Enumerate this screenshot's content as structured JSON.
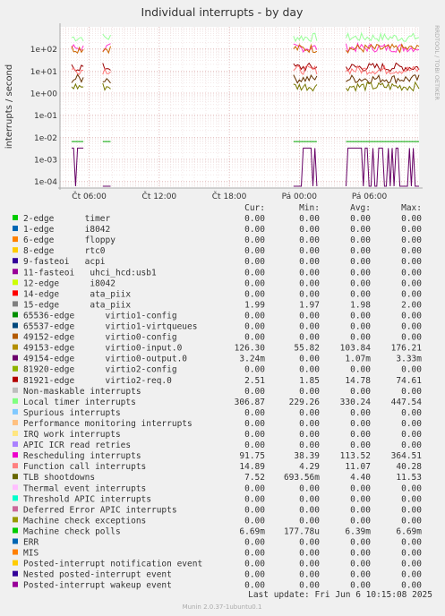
{
  "chart_data": {
    "type": "line",
    "title": "Individual interrupts - by day",
    "ylabel": "interrupts / second",
    "side_label": "RRDTOOL / TOBI OETIKER",
    "y_scale": "log",
    "ylim": [
      5e-05,
      1000
    ],
    "y_ticks": [
      "1e+02",
      "1e+01",
      "1e+00",
      "1e-01",
      "1e-02",
      "1e-03",
      "1e-04"
    ],
    "y_tick_values": [
      100,
      10,
      1,
      0.1,
      0.01,
      0.001,
      0.0001
    ],
    "x_ticks": [
      "Čt 06:00",
      "Čt 12:00",
      "Čt 18:00",
      "Pá 00:00",
      "Pá 06:00"
    ],
    "grid": true,
    "series_active_periods": [
      [
        "Čt 04:30",
        "Čt 05:30"
      ],
      [
        "Čt 07:10",
        "Čt 07:50"
      ],
      [
        "Čt 23:30",
        "Pá 01:30"
      ],
      [
        "Pá 04:00",
        "Pá 10:15"
      ]
    ],
    "series": [
      {
        "name": "Local timer interrupts",
        "color": "#99ff99",
        "level": 330
      },
      {
        "name": "Rescheduling interrupts",
        "color": "#ff33cc",
        "level": 113
      },
      {
        "name": "49153-edge virtio0-input.0",
        "color": "#cc6600",
        "level": 104
      },
      {
        "name": "TLB shootdowns",
        "color": "#663300",
        "level": 4.4
      },
      {
        "name": "81921-edge virtio2-req.0",
        "color": "#990000",
        "level": 14.78
      },
      {
        "name": "Function call interrupts",
        "color": "#ff7777",
        "level": 11.07
      },
      {
        "name": "15-edge ata_piix",
        "color": "#777700",
        "level": 1.98
      },
      {
        "name": "Machine check polls",
        "color": "#00aa00",
        "level": 0.00639
      },
      {
        "name": "49154-edge virtio0-output.0",
        "color": "#660066",
        "level": 0.00107
      }
    ]
  },
  "legend": {
    "headers": {
      "cur": "Cur:",
      "min": "Min:",
      "avg": "Avg:",
      "max": "Max:"
    },
    "rows": [
      {
        "label": "2-edge      timer",
        "color": "#00cc00",
        "cur": "0.00",
        "min": "0.00",
        "avg": "0.00",
        "max": "0.00"
      },
      {
        "label": "1-edge      i8042",
        "color": "#0066b3",
        "cur": "0.00",
        "min": "0.00",
        "avg": "0.00",
        "max": "0.00"
      },
      {
        "label": "6-edge      floppy",
        "color": "#ff8000",
        "cur": "0.00",
        "min": "0.00",
        "avg": "0.00",
        "max": "0.00"
      },
      {
        "label": "8-edge      rtc0",
        "color": "#ffcc00",
        "cur": "0.00",
        "min": "0.00",
        "avg": "0.00",
        "max": "0.00"
      },
      {
        "label": "9-fasteoi   acpi",
        "color": "#330099",
        "cur": "0.00",
        "min": "0.00",
        "avg": "0.00",
        "max": "0.00"
      },
      {
        "label": "11-fasteoi   uhci_hcd:usb1",
        "color": "#990099",
        "cur": "0.00",
        "min": "0.00",
        "avg": "0.00",
        "max": "0.00"
      },
      {
        "label": "12-edge      i8042",
        "color": "#ccff00",
        "cur": "0.00",
        "min": "0.00",
        "avg": "0.00",
        "max": "0.00"
      },
      {
        "label": "14-edge      ata_piix",
        "color": "#ff0000",
        "cur": "0.00",
        "min": "0.00",
        "avg": "0.00",
        "max": "0.00"
      },
      {
        "label": "15-edge      ata_piix",
        "color": "#808080",
        "cur": "1.99",
        "min": "1.97",
        "avg": "1.98",
        "max": "2.00"
      },
      {
        "label": "65536-edge      virtio1-config",
        "color": "#008f00",
        "cur": "0.00",
        "min": "0.00",
        "avg": "0.00",
        "max": "0.00"
      },
      {
        "label": "65537-edge      virtio1-virtqueues",
        "color": "#00487d",
        "cur": "0.00",
        "min": "0.00",
        "avg": "0.00",
        "max": "0.00"
      },
      {
        "label": "49152-edge      virtio0-config",
        "color": "#b35a00",
        "cur": "0.00",
        "min": "0.00",
        "avg": "0.00",
        "max": "0.00"
      },
      {
        "label": "49153-edge      virtio0-input.0",
        "color": "#b38f00",
        "cur": "126.30",
        "min": "55.82",
        "avg": "103.84",
        "max": "176.21"
      },
      {
        "label": "49154-edge      virtio0-output.0",
        "color": "#6b006b",
        "cur": "3.24m",
        "min": "0.00",
        "avg": "1.07m",
        "max": "3.33m"
      },
      {
        "label": "81920-edge      virtio2-config",
        "color": "#8fb300",
        "cur": "0.00",
        "min": "0.00",
        "avg": "0.00",
        "max": "0.00"
      },
      {
        "label": "81921-edge      virtio2-req.0",
        "color": "#b30000",
        "cur": "2.51",
        "min": "1.85",
        "avg": "14.78",
        "max": "74.61"
      },
      {
        "label": "Non-maskable interrupts",
        "color": "#bebebe",
        "cur": "0.00",
        "min": "0.00",
        "avg": "0.00",
        "max": "0.00"
      },
      {
        "label": "Local timer interrupts",
        "color": "#80ff80",
        "cur": "306.87",
        "min": "229.26",
        "avg": "330.24",
        "max": "447.54"
      },
      {
        "label": "Spurious interrupts",
        "color": "#80c9ff",
        "cur": "0.00",
        "min": "0.00",
        "avg": "0.00",
        "max": "0.00"
      },
      {
        "label": "Performance monitoring interrupts",
        "color": "#ffc080",
        "cur": "0.00",
        "min": "0.00",
        "avg": "0.00",
        "max": "0.00"
      },
      {
        "label": "IRQ work interrupts",
        "color": "#ffe680",
        "cur": "0.00",
        "min": "0.00",
        "avg": "0.00",
        "max": "0.00"
      },
      {
        "label": "APIC ICR read retries",
        "color": "#aa80ff",
        "cur": "0.00",
        "min": "0.00",
        "avg": "0.00",
        "max": "0.00"
      },
      {
        "label": "Rescheduling interrupts",
        "color": "#ee00cc",
        "cur": "91.75",
        "min": "38.39",
        "avg": "113.52",
        "max": "364.51"
      },
      {
        "label": "Function call interrupts",
        "color": "#ff8080",
        "cur": "14.89",
        "min": "4.29",
        "avg": "11.07",
        "max": "40.28"
      },
      {
        "label": "TLB shootdowns",
        "color": "#666600",
        "cur": "7.52",
        "min": "693.56m",
        "avg": "4.40",
        "max": "11.53"
      },
      {
        "label": "Thermal event interrupts",
        "color": "#ffbfff",
        "cur": "0.00",
        "min": "0.00",
        "avg": "0.00",
        "max": "0.00"
      },
      {
        "label": "Threshold APIC interrupts",
        "color": "#00ffcc",
        "cur": "0.00",
        "min": "0.00",
        "avg": "0.00",
        "max": "0.00"
      },
      {
        "label": "Deferred Error APIC interrupts",
        "color": "#cc6699",
        "cur": "0.00",
        "min": "0.00",
        "avg": "0.00",
        "max": "0.00"
      },
      {
        "label": "Machine check exceptions",
        "color": "#999900",
        "cur": "0.00",
        "min": "0.00",
        "avg": "0.00",
        "max": "0.00"
      },
      {
        "label": "Machine check polls",
        "color": "#00cc00",
        "cur": "6.69m",
        "min": "177.78u",
        "avg": "6.39m",
        "max": "6.69m"
      },
      {
        "label": "ERR",
        "color": "#0066b3",
        "cur": "0.00",
        "min": "0.00",
        "avg": "0.00",
        "max": "0.00"
      },
      {
        "label": "MIS",
        "color": "#ff8000",
        "cur": "0.00",
        "min": "0.00",
        "avg": "0.00",
        "max": "0.00"
      },
      {
        "label": "Posted-interrupt notification event",
        "color": "#ffcc00",
        "cur": "0.00",
        "min": "0.00",
        "avg": "0.00",
        "max": "0.00"
      },
      {
        "label": "Nested posted-interrupt event",
        "color": "#330099",
        "cur": "0.00",
        "min": "0.00",
        "avg": "0.00",
        "max": "0.00"
      },
      {
        "label": "Posted-interrupt wakeup event",
        "color": "#990099",
        "cur": "0.00",
        "min": "0.00",
        "avg": "0.00",
        "max": "0.00"
      }
    ]
  },
  "last_update": "Last update: Fri Jun  6 10:15:08 2025",
  "footer": "Munin 2.0.37-1ubuntu0.1"
}
